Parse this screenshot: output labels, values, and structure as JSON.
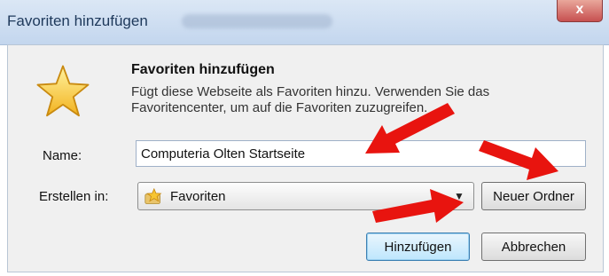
{
  "window": {
    "title": "Favoriten hinzufügen",
    "close_glyph": "x",
    "close_color": "#c75050"
  },
  "dialog": {
    "icon": "star-icon",
    "heading": "Favoriten hinzufügen",
    "description": "Fügt diese Webseite als Favoriten hinzu. Verwenden Sie das Favoritencenter, um auf die Favoriten zuzugreifen."
  },
  "form": {
    "name_label": "Name:",
    "name_value": "Computeria Olten Startseite",
    "create_in_label": "Erstellen in:",
    "create_in_value": "Favoriten",
    "create_in_icon": "folder-star-icon",
    "dropdown_glyph": "▼"
  },
  "buttons": {
    "new_folder": "Neuer Ordner",
    "add": "Hinzufügen",
    "cancel": "Abbrechen"
  },
  "annotations": {
    "arrow_color": "#e8140f"
  }
}
